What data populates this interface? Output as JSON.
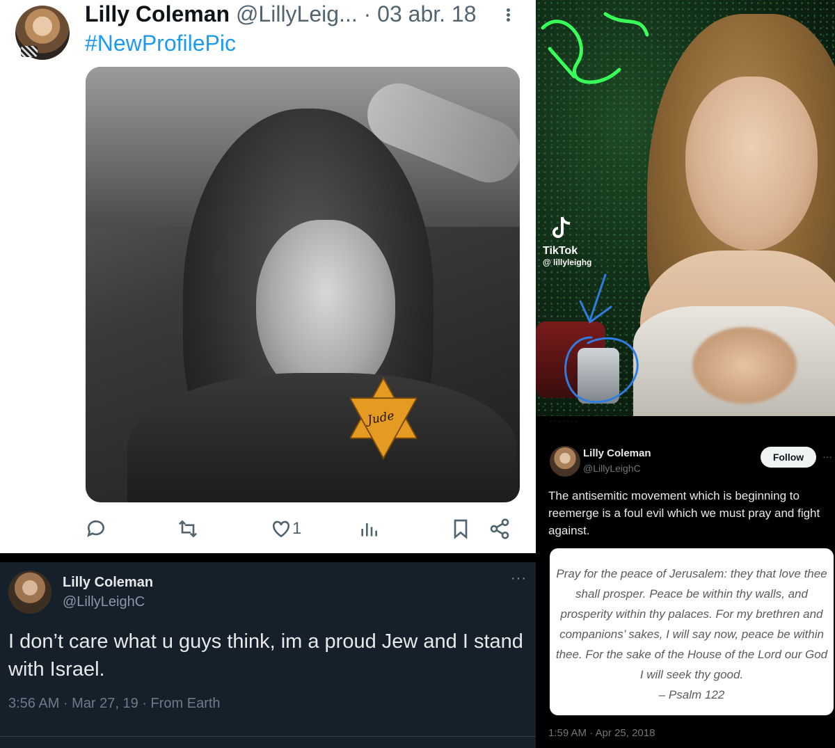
{
  "panel1": {
    "display_name": "Lilly Coleman",
    "handle": "@LillyLeig...",
    "date": "· 03 abr. 18",
    "hashtag": "#NewProfilePic",
    "image": {
      "star_label": "Jude",
      "star_color": "#e59a22"
    },
    "actions": {
      "reply_icon": "reply-icon",
      "retweet_icon": "retweet-icon",
      "like_icon": "heart-icon",
      "like_count": "1",
      "views_icon": "views-icon",
      "bookmark_icon": "bookmark-icon",
      "share_icon": "share-icon"
    },
    "colors": {
      "hashtag": "#1d9bf0",
      "muted": "#536471"
    }
  },
  "panel2": {
    "brand": "TikTok",
    "username": "@ lillyleighg",
    "annotation_color": "#2f7de0",
    "neon_color": "#39ff5a"
  },
  "panel3": {
    "display_name": "Lilly Coleman",
    "handle": "@LillyLeighC",
    "more": "···",
    "text": "I don’t care what u guys think, im a proud Jew and I stand with Israel.",
    "meta": "3:56 AM · Mar 27, 19 · From Earth",
    "colors": {
      "background": "#15202b"
    }
  },
  "panel4": {
    "cutoff_text": "· · · · · · ·",
    "display_name": "Lilly Coleman",
    "handle": "@LillyLeighC",
    "follow_label": "Follow",
    "more": "···",
    "text": "The antisemitic movement which is beginning to reemerge is a foul evil which we must pray and fight against.",
    "quote": "Pray for the peace of Jerusalem: they that love thee shall prosper. Peace be within thy walls, and prosperity within thy palaces. For my brethren and companions’ sakes, I will say now, peace be within thee. For the sake of the House of the Lord our God I will seek thy good.",
    "quote_ref": "– Psalm 122",
    "meta": "1:59 AM · Apr 25, 2018"
  }
}
